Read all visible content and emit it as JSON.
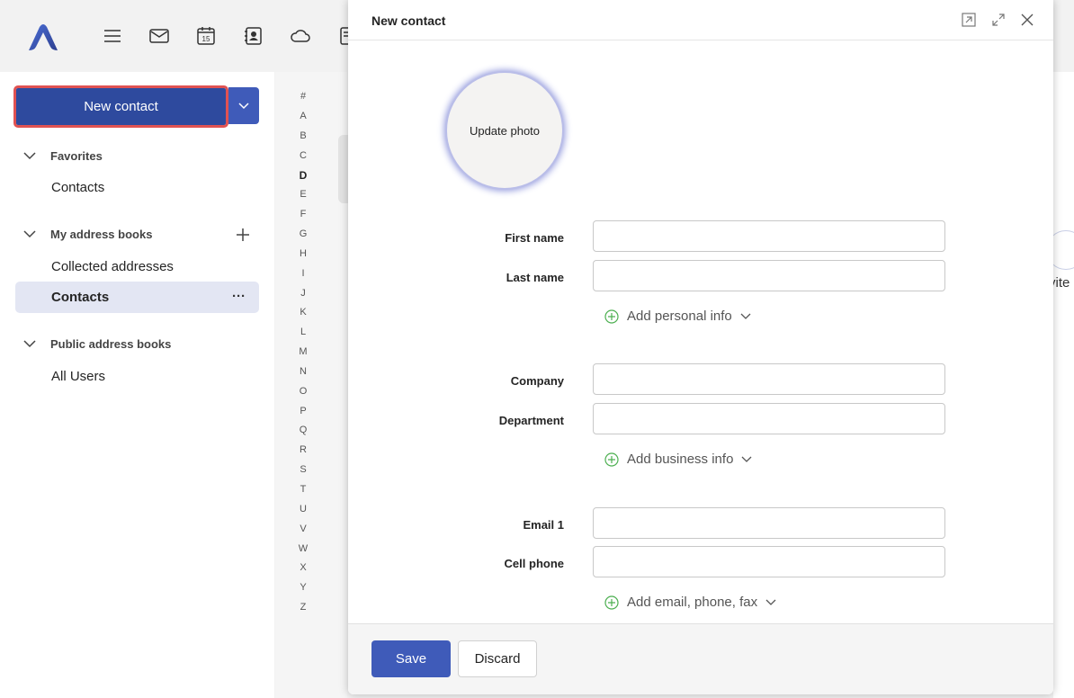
{
  "toolbar": {
    "icons": [
      "menu-icon",
      "mail-icon",
      "calendar-icon",
      "contacts-icon",
      "cloud-icon"
    ],
    "calendar_day": "15"
  },
  "sidebar": {
    "new_contact_label": "New contact",
    "sections": [
      {
        "label": "Favorites",
        "items": [
          "Contacts"
        ]
      },
      {
        "label": "My address books",
        "items": [
          "Collected addresses",
          "Contacts"
        ]
      },
      {
        "label": "Public address books",
        "items": [
          "All Users"
        ]
      }
    ],
    "selected_item": "Contacts",
    "more_label": "···"
  },
  "alphabet": [
    "#",
    "A",
    "B",
    "C",
    "D",
    "E",
    "F",
    "G",
    "H",
    "I",
    "J",
    "K",
    "L",
    "M",
    "N",
    "O",
    "P",
    "Q",
    "R",
    "S",
    "T",
    "U",
    "V",
    "W",
    "X",
    "Y",
    "Z"
  ],
  "alphabet_active": "D",
  "right_peek_text": "vite",
  "dialog": {
    "title": "New contact",
    "photo_label": "Update photo",
    "fields": {
      "first_name": {
        "label": "First name",
        "value": ""
      },
      "last_name": {
        "label": "Last name",
        "value": ""
      },
      "company": {
        "label": "Company",
        "value": ""
      },
      "department": {
        "label": "Department",
        "value": ""
      },
      "email1": {
        "label": "Email 1",
        "value": ""
      },
      "cell_phone": {
        "label": "Cell phone",
        "value": ""
      }
    },
    "add_personal": "Add personal info",
    "add_business": "Add business info",
    "add_contact": "Add email, phone, fax",
    "save_label": "Save",
    "discard_label": "Discard"
  },
  "colors": {
    "primary": "#3f5bb9",
    "primary_dark": "#2e4a9e",
    "highlight_border": "#e05252",
    "add_icon_green": "#4caf50"
  }
}
